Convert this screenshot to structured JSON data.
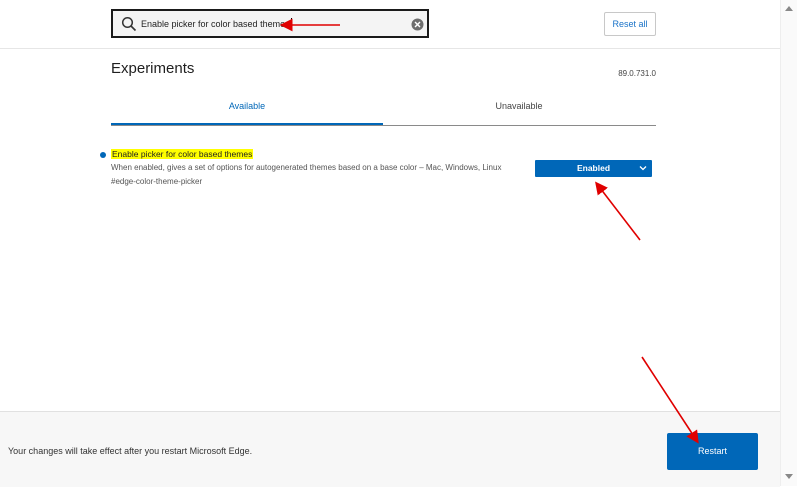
{
  "search": {
    "value": "Enable picker for color based themes",
    "icon": "search-icon",
    "clear_icon": "clear-icon"
  },
  "header": {
    "reset_all_label": "Reset all"
  },
  "page": {
    "title": "Experiments",
    "version": "89.0.731.0"
  },
  "tabs": [
    {
      "label": "Available",
      "selected": true
    },
    {
      "label": "Unavailable",
      "selected": false
    }
  ],
  "flag": {
    "title": "Enable picker for color based themes",
    "description": "When enabled, gives a set of options for autogenerated themes based on a base color – Mac, Windows, Linux",
    "id": "#edge-color-theme-picker",
    "state": "Enabled"
  },
  "footer": {
    "message": "Your changes will take effect after you restart Microsoft Edge.",
    "restart_label": "Restart"
  },
  "colors": {
    "accent": "#0067b8",
    "highlight": "#ffff00",
    "annotation_arrow": "#e00000"
  }
}
